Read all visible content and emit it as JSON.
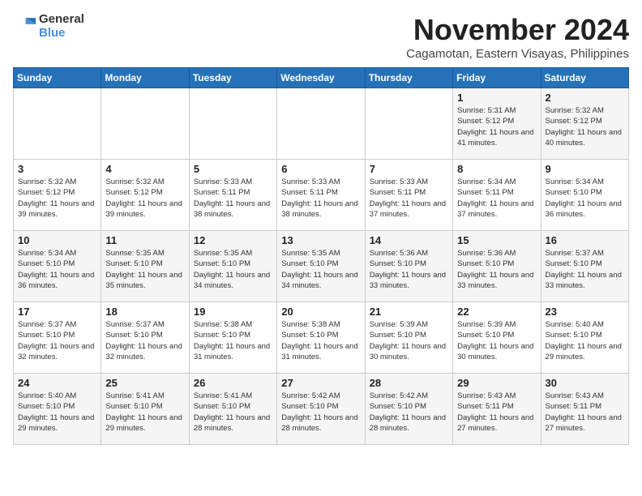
{
  "logo": {
    "general": "General",
    "blue": "Blue"
  },
  "title": "November 2024",
  "location": "Cagamotan, Eastern Visayas, Philippines",
  "days_of_week": [
    "Sunday",
    "Monday",
    "Tuesday",
    "Wednesday",
    "Thursday",
    "Friday",
    "Saturday"
  ],
  "weeks": [
    [
      {
        "day": "",
        "info": ""
      },
      {
        "day": "",
        "info": ""
      },
      {
        "day": "",
        "info": ""
      },
      {
        "day": "",
        "info": ""
      },
      {
        "day": "",
        "info": ""
      },
      {
        "day": "1",
        "info": "Sunrise: 5:31 AM\nSunset: 5:12 PM\nDaylight: 11 hours and 41 minutes."
      },
      {
        "day": "2",
        "info": "Sunrise: 5:32 AM\nSunset: 5:12 PM\nDaylight: 11 hours and 40 minutes."
      }
    ],
    [
      {
        "day": "3",
        "info": "Sunrise: 5:32 AM\nSunset: 5:12 PM\nDaylight: 11 hours and 39 minutes."
      },
      {
        "day": "4",
        "info": "Sunrise: 5:32 AM\nSunset: 5:12 PM\nDaylight: 11 hours and 39 minutes."
      },
      {
        "day": "5",
        "info": "Sunrise: 5:33 AM\nSunset: 5:11 PM\nDaylight: 11 hours and 38 minutes."
      },
      {
        "day": "6",
        "info": "Sunrise: 5:33 AM\nSunset: 5:11 PM\nDaylight: 11 hours and 38 minutes."
      },
      {
        "day": "7",
        "info": "Sunrise: 5:33 AM\nSunset: 5:11 PM\nDaylight: 11 hours and 37 minutes."
      },
      {
        "day": "8",
        "info": "Sunrise: 5:34 AM\nSunset: 5:11 PM\nDaylight: 11 hours and 37 minutes."
      },
      {
        "day": "9",
        "info": "Sunrise: 5:34 AM\nSunset: 5:10 PM\nDaylight: 11 hours and 36 minutes."
      }
    ],
    [
      {
        "day": "10",
        "info": "Sunrise: 5:34 AM\nSunset: 5:10 PM\nDaylight: 11 hours and 36 minutes."
      },
      {
        "day": "11",
        "info": "Sunrise: 5:35 AM\nSunset: 5:10 PM\nDaylight: 11 hours and 35 minutes."
      },
      {
        "day": "12",
        "info": "Sunrise: 5:35 AM\nSunset: 5:10 PM\nDaylight: 11 hours and 34 minutes."
      },
      {
        "day": "13",
        "info": "Sunrise: 5:35 AM\nSunset: 5:10 PM\nDaylight: 11 hours and 34 minutes."
      },
      {
        "day": "14",
        "info": "Sunrise: 5:36 AM\nSunset: 5:10 PM\nDaylight: 11 hours and 33 minutes."
      },
      {
        "day": "15",
        "info": "Sunrise: 5:36 AM\nSunset: 5:10 PM\nDaylight: 11 hours and 33 minutes."
      },
      {
        "day": "16",
        "info": "Sunrise: 5:37 AM\nSunset: 5:10 PM\nDaylight: 11 hours and 33 minutes."
      }
    ],
    [
      {
        "day": "17",
        "info": "Sunrise: 5:37 AM\nSunset: 5:10 PM\nDaylight: 11 hours and 32 minutes."
      },
      {
        "day": "18",
        "info": "Sunrise: 5:37 AM\nSunset: 5:10 PM\nDaylight: 11 hours and 32 minutes."
      },
      {
        "day": "19",
        "info": "Sunrise: 5:38 AM\nSunset: 5:10 PM\nDaylight: 11 hours and 31 minutes."
      },
      {
        "day": "20",
        "info": "Sunrise: 5:38 AM\nSunset: 5:10 PM\nDaylight: 11 hours and 31 minutes."
      },
      {
        "day": "21",
        "info": "Sunrise: 5:39 AM\nSunset: 5:10 PM\nDaylight: 11 hours and 30 minutes."
      },
      {
        "day": "22",
        "info": "Sunrise: 5:39 AM\nSunset: 5:10 PM\nDaylight: 11 hours and 30 minutes."
      },
      {
        "day": "23",
        "info": "Sunrise: 5:40 AM\nSunset: 5:10 PM\nDaylight: 11 hours and 29 minutes."
      }
    ],
    [
      {
        "day": "24",
        "info": "Sunrise: 5:40 AM\nSunset: 5:10 PM\nDaylight: 11 hours and 29 minutes."
      },
      {
        "day": "25",
        "info": "Sunrise: 5:41 AM\nSunset: 5:10 PM\nDaylight: 11 hours and 29 minutes."
      },
      {
        "day": "26",
        "info": "Sunrise: 5:41 AM\nSunset: 5:10 PM\nDaylight: 11 hours and 28 minutes."
      },
      {
        "day": "27",
        "info": "Sunrise: 5:42 AM\nSunset: 5:10 PM\nDaylight: 11 hours and 28 minutes."
      },
      {
        "day": "28",
        "info": "Sunrise: 5:42 AM\nSunset: 5:10 PM\nDaylight: 11 hours and 28 minutes."
      },
      {
        "day": "29",
        "info": "Sunrise: 5:43 AM\nSunset: 5:11 PM\nDaylight: 11 hours and 27 minutes."
      },
      {
        "day": "30",
        "info": "Sunrise: 5:43 AM\nSunset: 5:11 PM\nDaylight: 11 hours and 27 minutes."
      }
    ]
  ]
}
